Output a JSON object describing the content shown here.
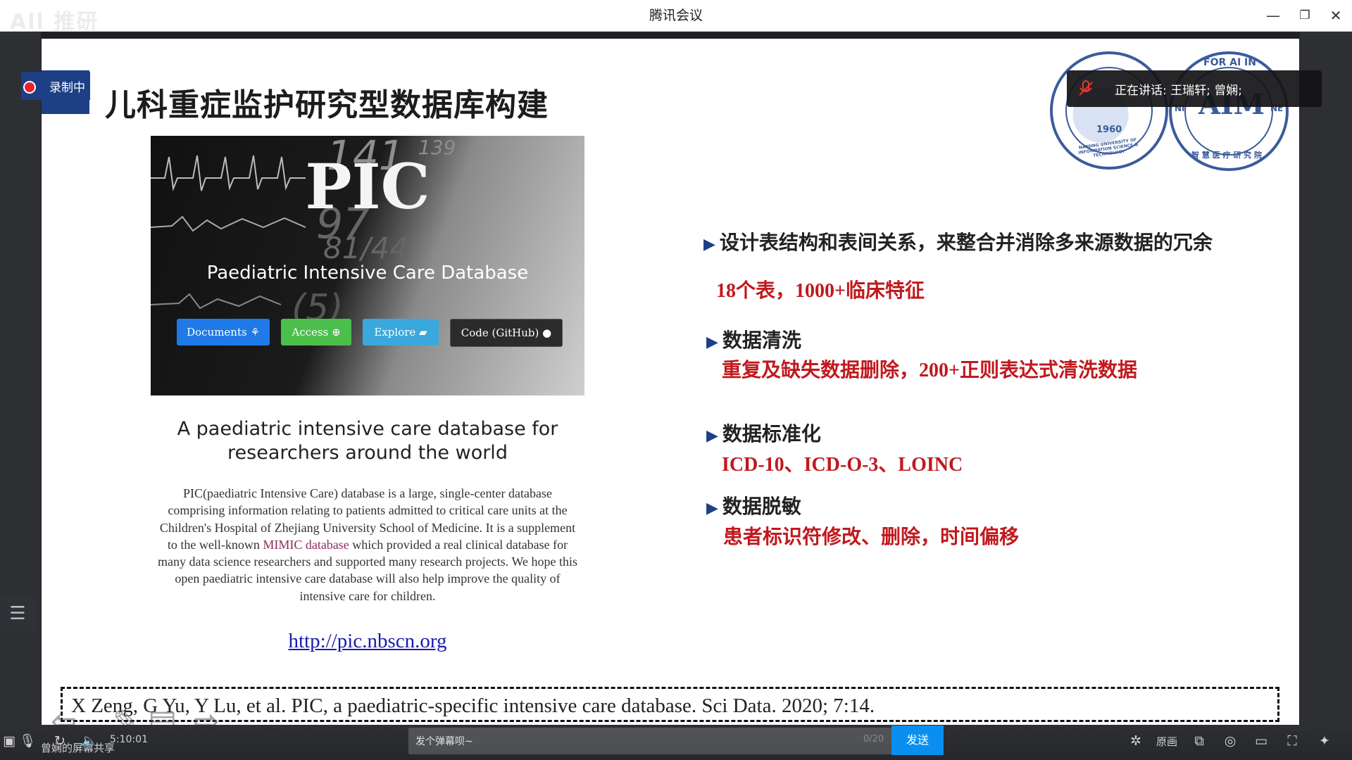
{
  "window": {
    "title": "腾讯会议",
    "controls": {
      "minimize": "—",
      "restore": "❐",
      "close": "✕"
    },
    "watermark": "All 推研"
  },
  "recording": {
    "label": "录制中",
    "color": "#e4262c"
  },
  "speaking": {
    "text": "正在讲话: 王瑞轩; 曾娴;"
  },
  "slide": {
    "title": "儿科重症监护研究型数据库构建",
    "logos": {
      "left": {
        "year": "1960",
        "arc_text": "NANJING UNIVERSITY OF INFORMATION SCIENCE & TECHNOLOGY"
      },
      "right": {
        "arc_top": "FOR AI IN",
        "mark": "AIM",
        "arc_bottom": "智 慧 医 疗 研 究 院",
        "left_letters": "NI",
        "right_letters": "NE"
      }
    },
    "banner": {
      "headline": "PIC",
      "subtitle": "Paediatric Intensive Care Database",
      "bg_numbers": [
        "141",
        "139",
        "97",
        "81/44",
        "(5)"
      ],
      "buttons": [
        {
          "label": "Documents ⚘",
          "color": "#1f7ae8"
        },
        {
          "label": "Access ⊕",
          "color": "#4cbe4c"
        },
        {
          "label": "Explore ▰",
          "color": "#3aa8dd"
        },
        {
          "label": "Code (GitHub) ●",
          "color": "#2b2b2b"
        }
      ]
    },
    "description": {
      "heading": "A paediatric intensive care database for researchers around the world",
      "body_pre": "PIC(paediatric Intensive Care) database is a large, single-center database comprising information relating to patients admitted to critical care units at the Children's Hospital of Zhejiang University School of Medicine. It is a supplement to the well-known ",
      "body_link": "MIMIC database",
      "body_post": " which provided a real clinical database for many data science researchers and supported many research projects. We hope this open paediatric intensive care database will also help improve the quality of intensive care for children.",
      "url": "http://pic.nbscn.org"
    },
    "bullets": [
      {
        "heading": "设计表结构和表间关系，来整合并消除多来源数据的冗余",
        "detail": "18个表，1000+临床特征"
      },
      {
        "heading": "数据清洗",
        "detail": "重复及缺失数据删除，200+正则表达式清洗数据"
      },
      {
        "heading": "数据标准化",
        "detail": "ICD-10、ICD-O-3、LOINC"
      },
      {
        "heading": "数据脱敏",
        "detail": "患者标识符修改、删除，时间偏移"
      }
    ],
    "citation": "X Zeng, G Yu, Y Lu, et al. PIC, a paediatric-specific intensive care database. Sci Data. 2020; 7:14."
  },
  "bottom_bar": {
    "share_label": "曾娴的屏幕共享",
    "time": "5:10:01",
    "danmu_placeholder": "发个弹幕呗~",
    "danmu_count": "0/20",
    "send_label": "发送",
    "original_label": "原画"
  }
}
